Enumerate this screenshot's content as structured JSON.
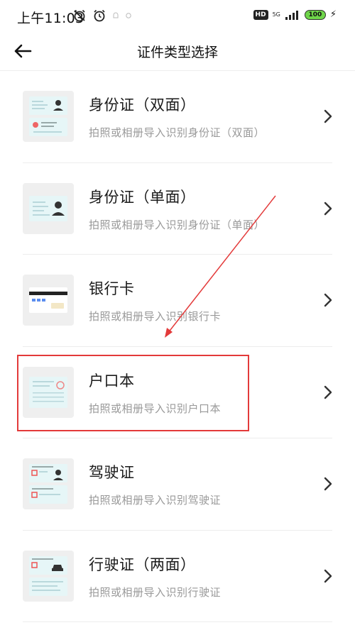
{
  "status": {
    "time": "上午11:03",
    "hd": "HD",
    "network": "5G",
    "battery": "100"
  },
  "header": {
    "title": "证件类型选择"
  },
  "items": [
    {
      "title": "身份证（双面）",
      "subtitle": "拍照或相册导入识别身份证（双面）",
      "icon": "id-card-double-icon"
    },
    {
      "title": "身份证（单面）",
      "subtitle": "拍照或相册导入识别身份证（单面）",
      "icon": "id-card-single-icon"
    },
    {
      "title": "银行卡",
      "subtitle": "拍照或相册导入识别银行卡",
      "icon": "bank-card-icon"
    },
    {
      "title": "户口本",
      "subtitle": "拍照或相册导入识别户口本",
      "icon": "household-register-icon"
    },
    {
      "title": "驾驶证",
      "subtitle": "拍照或相册导入识别驾驶证",
      "icon": "driver-license-icon"
    },
    {
      "title": "行驶证（两面）",
      "subtitle": "拍照或相册导入识别行驶证",
      "icon": "vehicle-license-icon"
    }
  ],
  "colors": {
    "annotation": "#e33a3a",
    "card_bg": "#e6f6f7",
    "thumb_bg": "#efefef",
    "subtitle": "#999999"
  }
}
